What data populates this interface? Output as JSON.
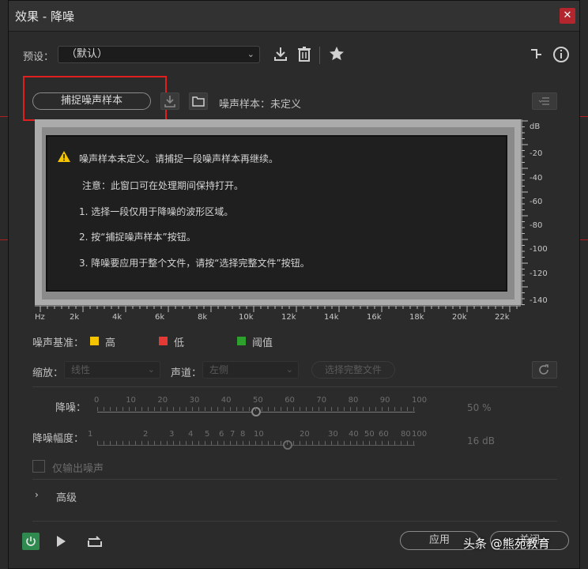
{
  "window": {
    "title": "效果 - 降噪",
    "close_glyph": "✕"
  },
  "preset": {
    "label": "预设：",
    "value": "（默认）"
  },
  "toolbar_icons": [
    "download-icon",
    "trash-icon",
    "star-icon",
    "routing-icon",
    "info-icon"
  ],
  "capture": {
    "button_label": "捕捉噪声样本",
    "sample_label": "噪声样本：未定义"
  },
  "message": {
    "line1": "噪声样本未定义。请捕捉一段噪声样本再继续。",
    "line2": "注意：此窗口可在处理期间保持打开。",
    "line3": "1. 选择一段仅用于降噪的波形区域。",
    "line4": "2. 按“捕捉噪声样本”按钮。",
    "line5": "3. 降噪要应用于整个文件，请按“选择完整文件”按钮。"
  },
  "graph": {
    "y_ticks": [
      "dB",
      "-20",
      "-40",
      "-60",
      "-80",
      "-100",
      "-120",
      "-140"
    ],
    "x_ticks": [
      "Hz",
      "2k",
      "4k",
      "6k",
      "8k",
      "10k",
      "12k",
      "14k",
      "16k",
      "18k",
      "20k",
      "22k"
    ]
  },
  "legend": {
    "label": "噪声基准：",
    "high": "高",
    "low": "低",
    "threshold": "阈值",
    "colors": {
      "high": "#f5c400",
      "low": "#e53935",
      "threshold": "#2ea02e"
    }
  },
  "scale": {
    "label": "缩放：",
    "value": "线性"
  },
  "channel": {
    "label": "声道：",
    "value": "左侧"
  },
  "select_full_button": "选择完整文件",
  "noise_reduction": {
    "label": "降噪：",
    "ticks": [
      "0",
      "10",
      "20",
      "30",
      "40",
      "50",
      "60",
      "70",
      "80",
      "90",
      "100"
    ],
    "value": "50 %",
    "level": 0.5
  },
  "reduce_by": {
    "label": "降噪幅度：",
    "ticks": [
      "1",
      "2",
      "3",
      "4",
      "5",
      "6",
      "7",
      "8",
      "10",
      "20",
      "30",
      "40",
      "50",
      "60",
      "80",
      "100"
    ],
    "value": "16 dB"
  },
  "output_noise_only": "仅输出噪声",
  "advanced": "高级",
  "bottom": {
    "apply": "应用",
    "close": "关闭"
  },
  "watermark": "头条 @熊苑教育"
}
